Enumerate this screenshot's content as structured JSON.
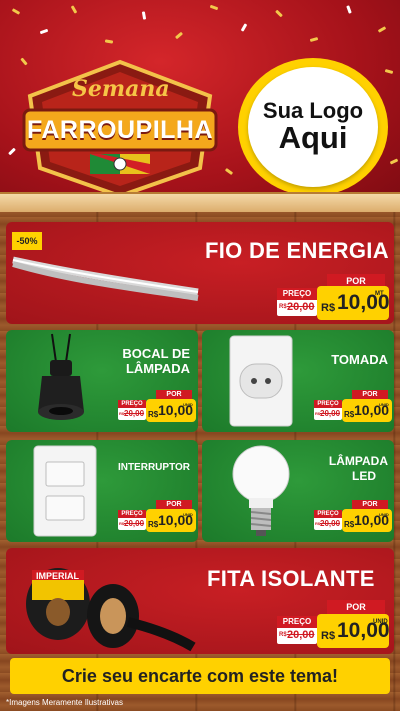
{
  "header": {
    "badge_line1": "Semana",
    "badge_line2": "FARROUPILHA",
    "logo_line1": "Sua Logo",
    "logo_line2": "Aqui"
  },
  "discount_tag": "-50%",
  "products": {
    "fio": {
      "title": "FIO DE ENERGIA",
      "por": "POR",
      "preco": "PREÇO",
      "old_prefix": "R$",
      "old_value": "20,00",
      "currency": "R$",
      "value": "10,00",
      "unit": "MT"
    },
    "bocal": {
      "title_line1": "BOCAL DE",
      "title_line2": "LÂMPADA",
      "por": "POR",
      "preco": "PREÇO",
      "old_prefix": "R$",
      "old_value": "20,00",
      "currency": "R$",
      "value": "10,00",
      "unit": "UNID"
    },
    "tomada": {
      "title": "TOMADA",
      "por": "POR",
      "preco": "PREÇO",
      "old_prefix": "R$",
      "old_value": "20,00",
      "currency": "R$",
      "value": "10,00",
      "unit": "UNID"
    },
    "interruptor": {
      "title": "INTERRUPTOR",
      "por": "POR",
      "preco": "PREÇO",
      "old_prefix": "R$",
      "old_value": "20,00",
      "currency": "R$",
      "value": "10,00",
      "unit": "UNID"
    },
    "lampada": {
      "title_line1": "LÂMPADA",
      "title_line2": "LED",
      "por": "POR",
      "preco": "PREÇO",
      "old_prefix": "R$",
      "old_value": "20,00",
      "currency": "R$",
      "value": "10,00",
      "unit": "UNID"
    },
    "fita": {
      "title": "FITA ISOLANTE",
      "brand": "IMPERIAL",
      "por": "POR",
      "preco": "PREÇO",
      "old_prefix": "R$",
      "old_value": "20,00",
      "currency": "R$",
      "value": "10,00",
      "unit": "UNID"
    }
  },
  "footer": {
    "cta": "Crie seu encarte com este tema!",
    "disclaimer": "*Imagens Meramente Ilustrativas"
  },
  "colors": {
    "red": "#c81f24",
    "green": "#2e9a3a",
    "yellow": "#ffd100",
    "wood": "#8a4b22"
  }
}
